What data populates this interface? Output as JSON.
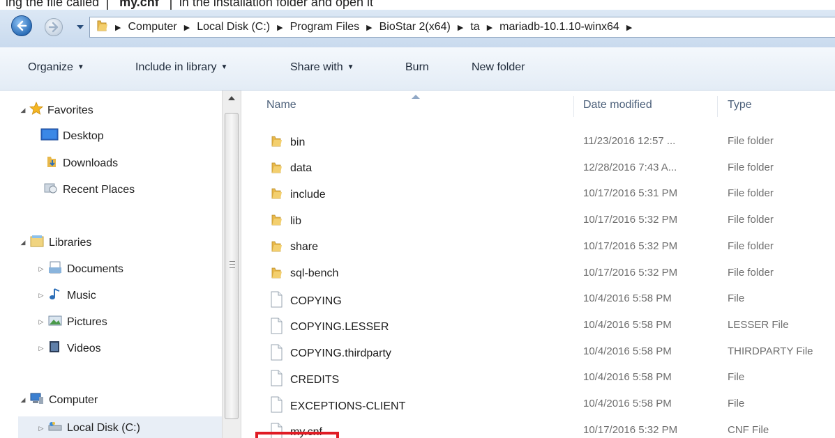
{
  "top_caption": {
    "before": "ing the file called",
    "boxed": "my.cnf",
    "after": "in the installation folder and open it"
  },
  "address": {
    "crumbs": [
      "Computer",
      "Local Disk (C:)",
      "Program Files",
      "BioStar 2(x64)",
      "ta",
      "mariadb-10.1.10-winx64"
    ]
  },
  "toolbar": {
    "organize": "Organize",
    "include": "Include in library",
    "share": "Share with",
    "burn": "Burn",
    "new_folder": "New folder"
  },
  "nav": {
    "favorites": "Favorites",
    "desktop": "Desktop",
    "downloads": "Downloads",
    "recent": "Recent Places",
    "libraries": "Libraries",
    "documents": "Documents",
    "music": "Music",
    "pictures": "Pictures",
    "videos": "Videos",
    "computer": "Computer",
    "localdisk": "Local Disk (C:)"
  },
  "columns": {
    "name": "Name",
    "date": "Date modified",
    "type": "Type"
  },
  "files": [
    {
      "name": "bin",
      "date": "11/23/2016 12:57 ...",
      "type": "File folder",
      "kind": "folder"
    },
    {
      "name": "data",
      "date": "12/28/2016 7:43 A...",
      "type": "File folder",
      "kind": "folder"
    },
    {
      "name": "include",
      "date": "10/17/2016 5:31 PM",
      "type": "File folder",
      "kind": "folder"
    },
    {
      "name": "lib",
      "date": "10/17/2016 5:32 PM",
      "type": "File folder",
      "kind": "folder"
    },
    {
      "name": "share",
      "date": "10/17/2016 5:32 PM",
      "type": "File folder",
      "kind": "folder"
    },
    {
      "name": "sql-bench",
      "date": "10/17/2016 5:32 PM",
      "type": "File folder",
      "kind": "folder"
    },
    {
      "name": "COPYING",
      "date": "10/4/2016 5:58 PM",
      "type": "File",
      "kind": "file"
    },
    {
      "name": "COPYING.LESSER",
      "date": "10/4/2016 5:58 PM",
      "type": "LESSER File",
      "kind": "file"
    },
    {
      "name": "COPYING.thirdparty",
      "date": "10/4/2016 5:58 PM",
      "type": "THIRDPARTY File",
      "kind": "file"
    },
    {
      "name": "CREDITS",
      "date": "10/4/2016 5:58 PM",
      "type": "File",
      "kind": "file"
    },
    {
      "name": "EXCEPTIONS-CLIENT",
      "date": "10/4/2016 5:58 PM",
      "type": "File",
      "kind": "file"
    },
    {
      "name": "my.cnf",
      "date": "10/17/2016 5:32 PM",
      "type": "CNF File",
      "kind": "file"
    }
  ],
  "colors": {
    "highlight": "#e01b24",
    "folder": "#e8b84a",
    "toolbar_bg": "#e3ecf6"
  }
}
